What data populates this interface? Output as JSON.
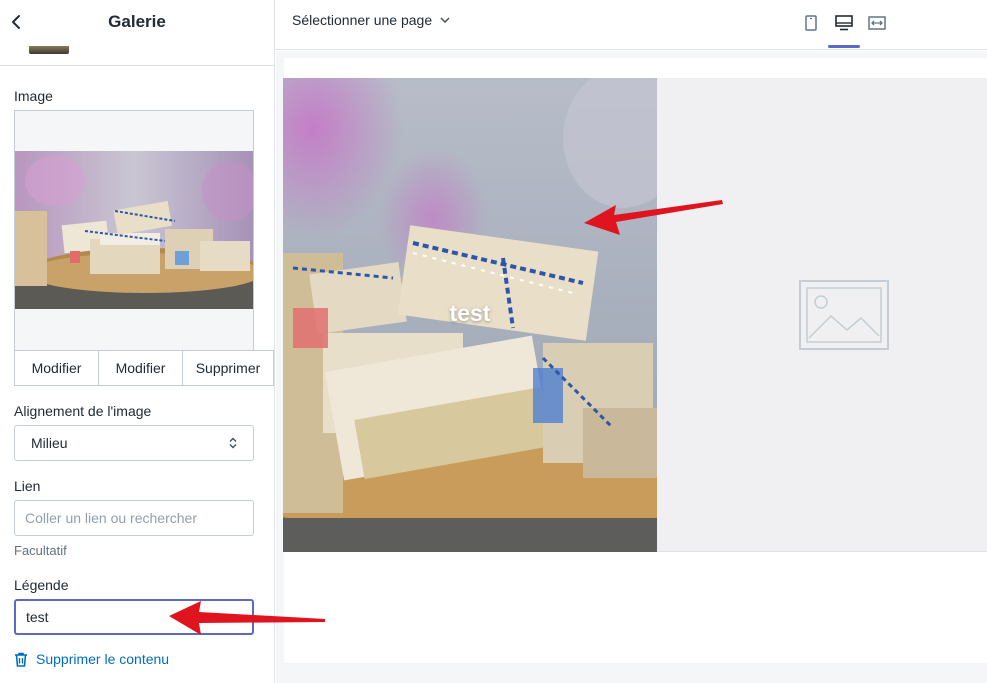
{
  "sidebar": {
    "title": "Galerie",
    "image_label": "Image",
    "buttons": [
      "Modifier",
      "Modifier",
      "Supprimer"
    ],
    "alignment_label": "Alignement de l'image",
    "alignment_value": "Milieu",
    "link_label": "Lien",
    "link_placeholder": "Coller un lien ou rechercher",
    "link_help": "Facultatif",
    "caption_label": "Légende",
    "caption_value": "test",
    "remove_label": "Supprimer le contenu"
  },
  "topbar": {
    "page_select": "Sélectionner une page"
  },
  "preview": {
    "caption": "test"
  },
  "colors": {
    "accent": "#5c6ac4",
    "link": "#006fbb",
    "annotation_arrow": "#e0141e"
  }
}
